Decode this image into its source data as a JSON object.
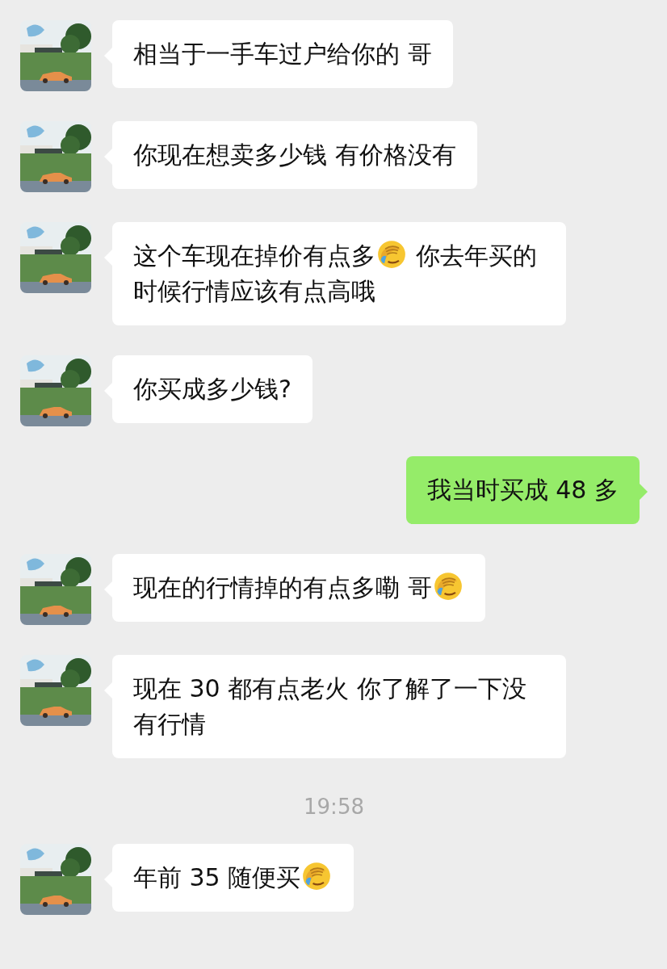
{
  "messages": [
    {
      "kind": "received",
      "parts": [
        {
          "kind": "text",
          "text": "相当于一手车过户给你的 哥"
        }
      ]
    },
    {
      "kind": "received",
      "parts": [
        {
          "kind": "text",
          "text": "你现在想卖多少钱 有价格没有"
        }
      ]
    },
    {
      "kind": "received",
      "parts": [
        {
          "kind": "text",
          "text": "这个车现在掉价有点多"
        },
        {
          "kind": "emoji"
        },
        {
          "kind": "text",
          "text": " 你去年买的时候行情应该有点高哦"
        }
      ]
    },
    {
      "kind": "received",
      "parts": [
        {
          "kind": "text",
          "text": "你买成多少钱?"
        }
      ]
    },
    {
      "kind": "sent",
      "parts": [
        {
          "kind": "text",
          "text": "我当时买成 48 多"
        }
      ]
    },
    {
      "kind": "received",
      "parts": [
        {
          "kind": "text",
          "text": "现在的行情掉的有点多嘞 哥"
        },
        {
          "kind": "emoji"
        }
      ]
    },
    {
      "kind": "received",
      "parts": [
        {
          "kind": "text",
          "text": "现在 30 都有点老火 你了解了一下没有行情"
        }
      ]
    },
    {
      "kind": "time",
      "text": "19:58"
    },
    {
      "kind": "received",
      "parts": [
        {
          "kind": "text",
          "text": "年前 35 随便买"
        },
        {
          "kind": "emoji"
        }
      ]
    }
  ]
}
